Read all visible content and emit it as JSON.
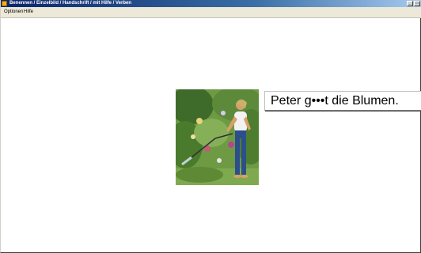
{
  "window": {
    "title": "Benennen / Einzelbild / Handschrift / mit Hilfe / Verben",
    "buttons": {
      "minimize": "_",
      "maximize": "□"
    }
  },
  "menu": {
    "items": [
      "Optionen",
      "Hilfe"
    ]
  },
  "exercise": {
    "image_description_icon": "woman-watering-garden",
    "sentence": "Peter g•••t die Blumen."
  },
  "colors": {
    "titlebar_start": "#0a246a",
    "titlebar_end": "#a6caf0",
    "menubar": "#ece9d8"
  }
}
